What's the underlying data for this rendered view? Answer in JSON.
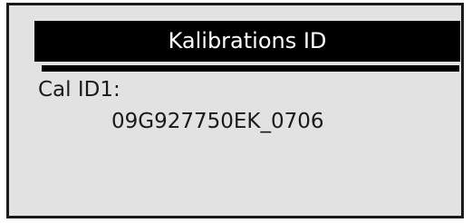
{
  "screen": {
    "title": "Kalibrations ID",
    "cal_id_label": "Cal ID1:",
    "cal_id_value": "09G927750EK_0706"
  },
  "colors": {
    "screen_background": "#e2e2e2",
    "title_background": "#000000",
    "title_text": "#ffffff",
    "body_text": "#1a1a1a",
    "border": "#1a1a1a"
  }
}
